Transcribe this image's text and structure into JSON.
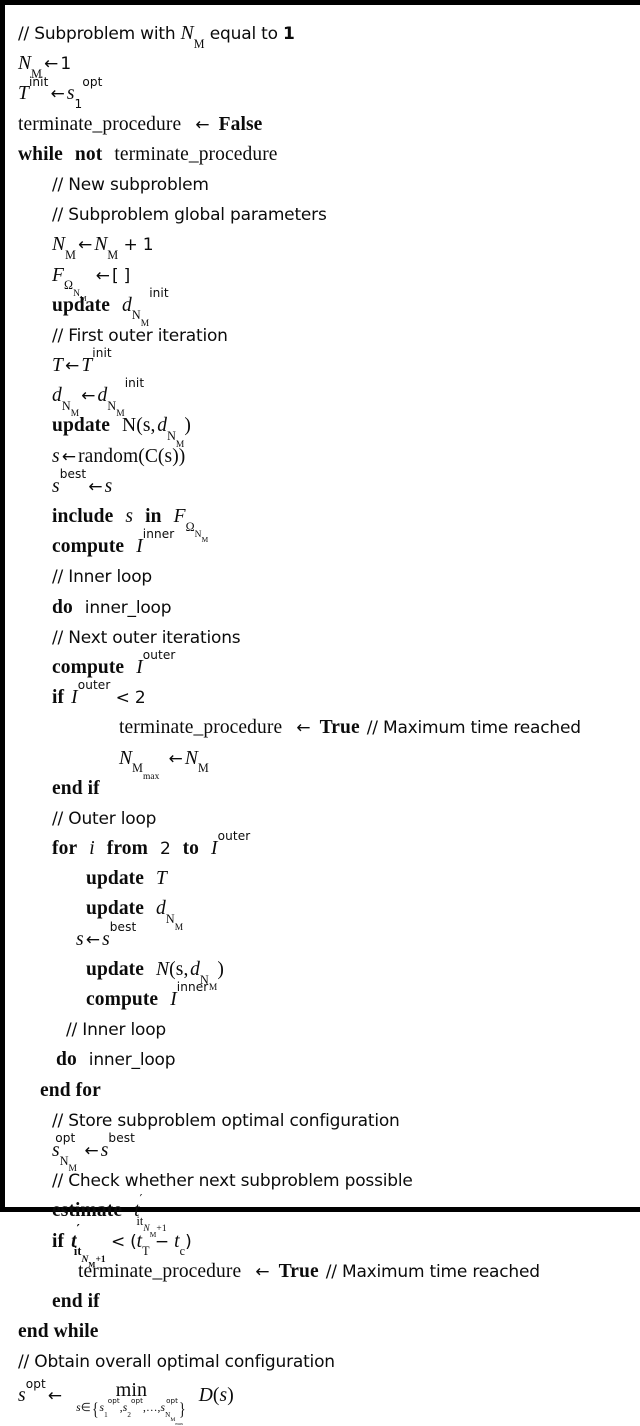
{
  "document": {
    "type": "algorithm-pseudocode",
    "title": "Subproblem with N_M equal to 1",
    "border_color": "#000000",
    "text_color": "#0b0b0b",
    "background_color": "#ffffff"
  },
  "symbols": {
    "arrow": "←",
    "less_than": "<",
    "element_of": "∈",
    "omega": "Ω",
    "minus": "−",
    "open_brace": "{",
    "close_brace": "}",
    "left_bracket": "[",
    "right_bracket": "]",
    "ellipsis": "…"
  },
  "lines": [
    {
      "id": "l1",
      "indent": 0,
      "kind": "comment",
      "text": "// Subproblem with N_M equal to 1",
      "parts": {
        "comment": "// Subproblem with ",
        "var": "N",
        "sub": "M",
        "tail": " equal to ",
        "bold": "1"
      }
    },
    {
      "id": "l2",
      "indent": 0,
      "kind": "assignment",
      "text": "N_M ← 1",
      "parts": {
        "lhs_var": "N",
        "lhs_sub": "M",
        "rhs": "1"
      }
    },
    {
      "id": "l3",
      "indent": 0,
      "kind": "assignment",
      "text": "T^init ← s_1^opt",
      "parts": {
        "lhs_var": "T",
        "lhs_sup": "init",
        "rhs_var": "s",
        "rhs_sub": "1",
        "rhs_sup": "opt"
      }
    },
    {
      "id": "l4",
      "indent": 0,
      "kind": "assignment",
      "text": "terminate_procedure ← False",
      "parts": {
        "lhs": "terminate_procedure",
        "rhs_bold": "False"
      }
    },
    {
      "id": "l5",
      "indent": 0,
      "kind": "control",
      "text": "while not terminate_procedure",
      "parts": {
        "kw1": "while",
        "kw2": "not",
        "operand": "terminate_procedure"
      }
    },
    {
      "id": "l6",
      "indent": 1,
      "kind": "comment",
      "text": "// New subproblem"
    },
    {
      "id": "l7",
      "indent": 1,
      "kind": "comment",
      "text": "// Subproblem global parameters"
    },
    {
      "id": "l8",
      "indent": 1,
      "kind": "assignment",
      "text": "N_M ← N_M + 1",
      "parts": {
        "lhs_var": "N",
        "lhs_sub": "M",
        "rhs_var": "N",
        "rhs_sub": "M",
        "rhs_tail": "+ 1"
      }
    },
    {
      "id": "l9",
      "indent": 1,
      "kind": "assignment",
      "text": "F_ΩN_M ← [ ]",
      "parts": {
        "lhs_var": "F",
        "lhs_sub_omega": "Ω",
        "lhs_sub_var": "N",
        "lhs_sub_sub": "M",
        "rhs": "[ ]"
      }
    },
    {
      "id": "l10",
      "indent": 1,
      "kind": "statement",
      "text": "update d_N_M^init",
      "parts": {
        "kw": "update",
        "var": "d",
        "sub_var": "N",
        "sub_sub": "M",
        "sup": "init"
      }
    },
    {
      "id": "l11",
      "indent": 1,
      "kind": "comment",
      "text": "// First outer iteration"
    },
    {
      "id": "l12",
      "indent": 1,
      "kind": "assignment",
      "text": "T ← T^init",
      "parts": {
        "lhs_var": "T",
        "rhs_var": "T",
        "rhs_sup": "init"
      }
    },
    {
      "id": "l13",
      "indent": 1,
      "kind": "assignment",
      "text": "d_N_M ← d_N_M^init",
      "parts": {
        "lhs_var": "d",
        "lhs_sub_var": "N",
        "lhs_sub_sub": "M",
        "rhs_var": "d",
        "rhs_sub_var": "N",
        "rhs_sub_sub": "M",
        "rhs_sup": "init"
      }
    },
    {
      "id": "l14",
      "indent": 1,
      "kind": "statement",
      "text": "update N(s, d_N_M)",
      "parts": {
        "kw": "update",
        "fn": "N(s,",
        "var": "d",
        "sub_var": "N",
        "sub_sub": "M",
        "close": ")"
      }
    },
    {
      "id": "l15",
      "indent": 1,
      "kind": "assignment",
      "text": "s ← random(C(s))",
      "parts": {
        "lhs_var": "s",
        "rhs": "random(C(s))"
      }
    },
    {
      "id": "l16",
      "indent": 1,
      "kind": "assignment",
      "text": "s^best ← s",
      "parts": {
        "lhs_var": "s",
        "lhs_sup": "best",
        "rhs_var": "s"
      }
    },
    {
      "id": "l17",
      "indent": 1,
      "kind": "statement",
      "text": "include s in F_ΩN_M",
      "parts": {
        "kw1": "include",
        "var1": "s",
        "kw2": "in",
        "var2": "F",
        "sub_omega": "Ω",
        "sub_var": "N",
        "sub_sub": "M"
      }
    },
    {
      "id": "l18",
      "indent": 1,
      "kind": "statement",
      "text": "compute I^inner",
      "parts": {
        "kw": "compute",
        "var": "I",
        "sup": "inner"
      }
    },
    {
      "id": "l19",
      "indent": 1,
      "kind": "comment",
      "text": "// Inner loop"
    },
    {
      "id": "l20",
      "indent": 1,
      "kind": "statement",
      "text": "do inner_loop",
      "parts": {
        "kw": "do",
        "var": "inner_loop"
      }
    },
    {
      "id": "l21",
      "indent": 1,
      "kind": "comment",
      "text": "// Next outer iterations"
    },
    {
      "id": "l22",
      "indent": 1,
      "kind": "statement",
      "text": "compute I^outer",
      "parts": {
        "kw": "compute",
        "var": "I",
        "sup": "outer"
      }
    },
    {
      "id": "l23",
      "indent": 1,
      "kind": "control",
      "text": "if I^outer < 2",
      "parts": {
        "kw": "if",
        "var": "I",
        "sup": "outer",
        "op": "<",
        "value": "2"
      }
    },
    {
      "id": "l24",
      "indent": 3,
      "kind": "assignment",
      "text": "terminate_procedure ← True // Maximum time reached",
      "parts": {
        "lhs": "terminate_procedure",
        "rhs_bold": "True",
        "comment": "// Maximum time reached"
      }
    },
    {
      "id": "l25",
      "indent": 3,
      "kind": "assignment",
      "text": "N_Mmax ← N_M",
      "parts": {
        "lhs_var": "N",
        "lhs_sub": "M",
        "lhs_sub_sub": "max",
        "rhs_var": "N",
        "rhs_sub": "M"
      }
    },
    {
      "id": "l26",
      "indent": 1,
      "kind": "control",
      "text": "end if"
    },
    {
      "id": "l27",
      "indent": 1,
      "kind": "comment",
      "text": "// Outer loop"
    },
    {
      "id": "l28",
      "indent": 1,
      "kind": "control",
      "text": "for i from 2 to I^outer",
      "parts": {
        "kw1": "for",
        "var": "i",
        "kw2": "from",
        "start": "2",
        "kw3": "to",
        "end_var": "I",
        "end_sup": "outer"
      }
    },
    {
      "id": "l29",
      "indent": 2,
      "kind": "statement",
      "text": "update T",
      "parts": {
        "kw": "update",
        "var": "T"
      }
    },
    {
      "id": "l30",
      "indent": 2,
      "kind": "statement",
      "text": "update d_N_M",
      "parts": {
        "kw": "update",
        "var": "d",
        "sub_var": "N",
        "sub_sub": "M"
      }
    },
    {
      "id": "l31",
      "indent": 2,
      "kind": "assignment",
      "text": "s ← s^best",
      "parts": {
        "lhs_var": "s",
        "rhs_var": "s",
        "rhs_sup": "best"
      }
    },
    {
      "id": "l32",
      "indent": 2,
      "kind": "statement",
      "text": "update N(s, d_N_M)",
      "parts": {
        "kw": "update",
        "fn": "N",
        "open": "(s,",
        "var": "d",
        "sub_var": "N",
        "sub_sub": "M",
        "close": ")"
      }
    },
    {
      "id": "l33",
      "indent": 2,
      "kind": "statement",
      "text": "compute I^inner",
      "parts": {
        "kw": "compute",
        "var": "I",
        "sup": "inner"
      }
    },
    {
      "id": "l34",
      "indent": 2,
      "kind": "comment",
      "text": "// Inner loop"
    },
    {
      "id": "l35",
      "indent": 2,
      "kind": "statement",
      "text": "do inner_loop",
      "parts": {
        "kw": "do",
        "var": "inner_loop"
      }
    },
    {
      "id": "l36",
      "indent": 1,
      "kind": "control",
      "text": "end for"
    },
    {
      "id": "l37",
      "indent": 1,
      "kind": "comment",
      "text": "// Store subproblem optimal configuration"
    },
    {
      "id": "l38",
      "indent": 1,
      "kind": "assignment",
      "text": "s_N_M^opt ← s^best",
      "parts": {
        "lhs_var": "s",
        "lhs_sup": "opt",
        "lhs_sub_var": "N",
        "lhs_sub_sub": "M",
        "rhs_var": "s",
        "rhs_sup": "best"
      }
    },
    {
      "id": "l39",
      "indent": 1,
      "kind": "comment",
      "text": "// Check whether next subproblem possible"
    },
    {
      "id": "l40",
      "indent": 1,
      "kind": "statement",
      "text": "estimate t'_itN_M+1",
      "parts": {
        "kw": "estimate",
        "var": "t",
        "prime": "′",
        "sub_it": "it",
        "sub_var": "N",
        "sub_sub": "M",
        "sub_tail": "+1"
      }
    },
    {
      "id": "l41",
      "indent": 1,
      "kind": "control",
      "text": "if t'_itN_M+1 < (t_T − t_c)",
      "parts": {
        "kw": "if",
        "var": "t",
        "prime": "′",
        "sub_it": "it",
        "sub_var": "N",
        "sub_sub": "M",
        "sub_tail": "+1",
        "op": "<",
        "rhs_open": "(",
        "rhs_var1": "t",
        "rhs_sub1": "T",
        "rhs_minus": "−",
        "rhs_var2": "t",
        "rhs_sub2": "c",
        "rhs_close": ")"
      }
    },
    {
      "id": "l42",
      "indent": 2,
      "kind": "assignment",
      "text": "terminate_procedure ← True // Maximum time reached",
      "parts": {
        "lhs": "terminate_procedure",
        "rhs_bold": "True",
        "comment": "// Maximum time reached"
      }
    },
    {
      "id": "l43",
      "indent": 1,
      "kind": "control",
      "text": "end if"
    },
    {
      "id": "l44",
      "indent": 0,
      "kind": "control",
      "text": "end while"
    },
    {
      "id": "l45",
      "indent": 0,
      "kind": "comment",
      "text": "// Obtain overall optimal configuration"
    },
    {
      "id": "l46",
      "indent": 0,
      "kind": "assignment",
      "text": "s^opt ← min_{s∈{s_1^opt, s_2^opt, …, s_N_Mmax^opt}} D(s)",
      "parts": {
        "lhs_var": "s",
        "lhs_sup": "opt",
        "min_label": "min",
        "set_prefix_var": "s",
        "set_prefix_op": "∈",
        "set_items": "s₁ᵒᵖᵗ, s₂ᵒᵖᵗ, …",
        "objective": "D(s)"
      }
    }
  ],
  "keywords": {
    "while": "while",
    "not": "not",
    "if": "if",
    "end_if": "end if",
    "end_while": "end while",
    "end_for": "end for",
    "for": "for",
    "from": "from",
    "to": "to",
    "do": "do",
    "update": "update",
    "compute": "compute",
    "include": "include",
    "in": "in",
    "estimate": "estimate",
    "true": "True",
    "false": "False"
  },
  "identifiers": {
    "terminate_procedure": "terminate_procedure",
    "inner_loop": "inner_loop",
    "random_call": "random(C(s))",
    "empty_list": "[ ]",
    "max_time_comment": "// Maximum time reached"
  }
}
